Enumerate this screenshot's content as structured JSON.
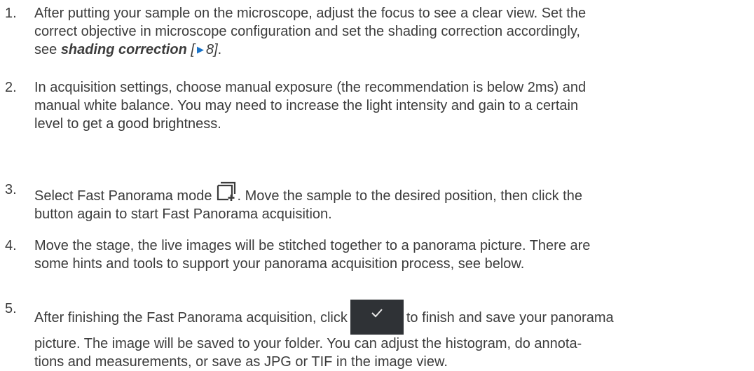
{
  "steps": [
    {
      "num": "1.",
      "line1": "After putting your sample on the microscope, adjust the focus to see a clear view. Set the",
      "line2": "correct objective in microscope configuration and set the shading correction accordingly,",
      "line3_pre": "see ",
      "link": "shading correction",
      "ref_open": "[",
      "ref_page": "8]",
      "line3_post": "."
    },
    {
      "num": "2.",
      "line1": "In acquisition settings, choose manual exposure (the recommendation is below 2ms) and",
      "line2": "manual white balance. You may need to increase the light intensity and gain to a certain",
      "line3": "level to get a good brightness."
    },
    {
      "num": "3.",
      "line1_pre": "Select Fast Panorama mode",
      "line1_post": ". Move the sample to the desired position, then click the",
      "line2": "button again to start Fast Panorama acquisition."
    },
    {
      "num": "4.",
      "line1": "Move the stage, the live images will be stitched together to a panorama picture. There are",
      "line2": "some hints and tools to support your panorama acquisition process, see below."
    },
    {
      "num": "5.",
      "line1_pre": "After finishing the Fast Panorama acquisition, click",
      "line1_post": "to finish and save your panorama",
      "line2": "picture. The image will be saved to your folder. You can adjust the histogram, do annota-",
      "line3": "tions and measurements, or save as JPG or TIF in the image view."
    }
  ],
  "icons": {
    "panorama": "fast-panorama-icon",
    "confirm": "checkmark-icon"
  },
  "colors": {
    "text": "#3c3c3c",
    "link_arrow": "#1a73c8",
    "button_bg": "#2f3236"
  }
}
